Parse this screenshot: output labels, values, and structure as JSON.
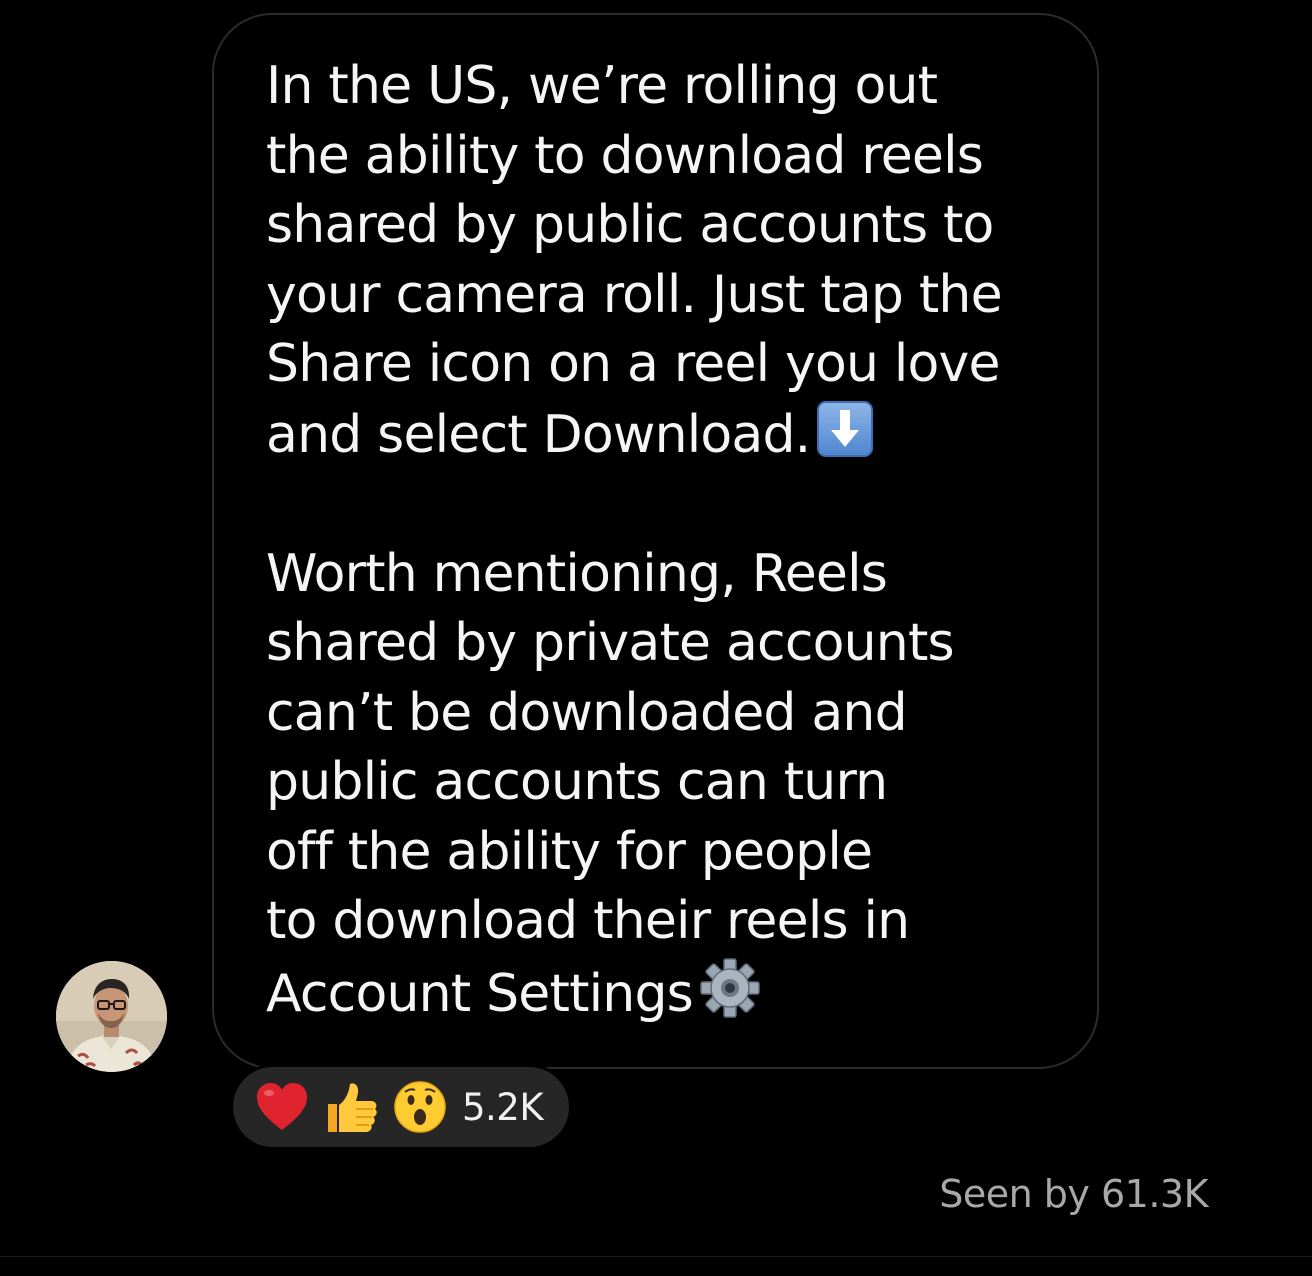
{
  "message": {
    "lines": [
      "In the US, we’re rolling out",
      "the ability to download reels",
      "shared by public accounts to",
      "your camera roll. Just tap the",
      "Share icon on a reel you love",
      "and select Download."
    ],
    "lines2": [
      "Worth mentioning, Reels",
      "shared by private accounts",
      "can’t be downloaded and",
      "public accounts can turn",
      "off the ability for people",
      "to download their reels in",
      "Account Settings"
    ],
    "inline_icons": [
      "down-arrow-emoji",
      "gear-emoji"
    ]
  },
  "reactions": {
    "icons": [
      "red-heart-emoji",
      "thumbs-up-emoji",
      "surprised-face-emoji"
    ],
    "count": "5.2K"
  },
  "seen": {
    "text": "Seen by 61.3K"
  },
  "colors": {
    "background": "#000000",
    "bubble_border": "#2b2b2d",
    "reaction_pill": "#262626",
    "seen_text": "#a8a8a8",
    "message_text": "#f5f5f5"
  }
}
